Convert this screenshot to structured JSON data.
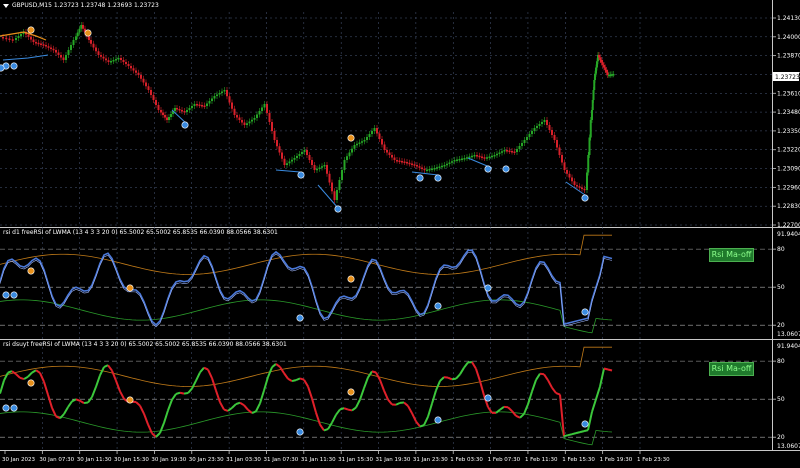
{
  "window": {
    "title": "GBPUSD,M15  1.23723 1.23748 1.23693 1.23723",
    "price_tag": "1.23723"
  },
  "main_chart": {
    "price_labels": [
      "1.24130",
      "1.24000",
      "1.23870",
      "1.23740",
      "1.23610",
      "1.23480",
      "1.23350",
      "1.23220",
      "1.23090",
      "1.22960",
      "1.22830",
      "1.22700"
    ]
  },
  "indicator1": {
    "header": "rsi d1 freeRSI of LWMA (13 4 3 3 20 0) 65.5002 65.5002 65.8535 66.0390 88.0566 38.6301",
    "badge": "Rsi Ma-off",
    "scale": {
      "top": "91.9404",
      "l80": "80",
      "l50": "50",
      "l20": "20",
      "bottom": "13.0607"
    }
  },
  "indicator2": {
    "header": "rsi dsuyt freeRSI of LWMA (13 4 3 3 20 0) 65.5002 65.5002 65.8535 66.0390 88.0566 38.6301",
    "badge": "Rsi Ma-off",
    "scale": {
      "top": "91.9404",
      "l80": "80",
      "l50": "50",
      "l20": "20",
      "bottom": "13.0607"
    }
  },
  "time_axis": {
    "labels": [
      "30 Jan 2023",
      "30 Jan 07:30",
      "30 Jan 11:30",
      "30 Jan 15:30",
      "30 Jan 19:30",
      "30 Jan 23:30",
      "31 Jan 03:30",
      "31 Jan 07:30",
      "31 Jan 11:30",
      "31 Jan 15:30",
      "31 Jan 19:30",
      "31 Jan 23:30",
      "1 Feb 03:30",
      "1 Feb 07:30",
      "1 Feb 11:30",
      "1 Feb 15:30",
      "1 Feb 19:30",
      "1 Feb 23:30"
    ]
  },
  "colors": {
    "background": "#000000",
    "grid": "#4b5a7a",
    "candle_up": "#26a626",
    "candle_down": "#d8202a",
    "ma_orange": "#e8901a",
    "zigzag_blue": "#3a8be0",
    "band_upper": "#c07a18",
    "band_lower": "#2a9a2a",
    "badge_bg": "#1f7a2c"
  },
  "icons": {
    "signal_marker": "swing-marker-icon",
    "dropdown": "triangle-down-icon"
  }
}
